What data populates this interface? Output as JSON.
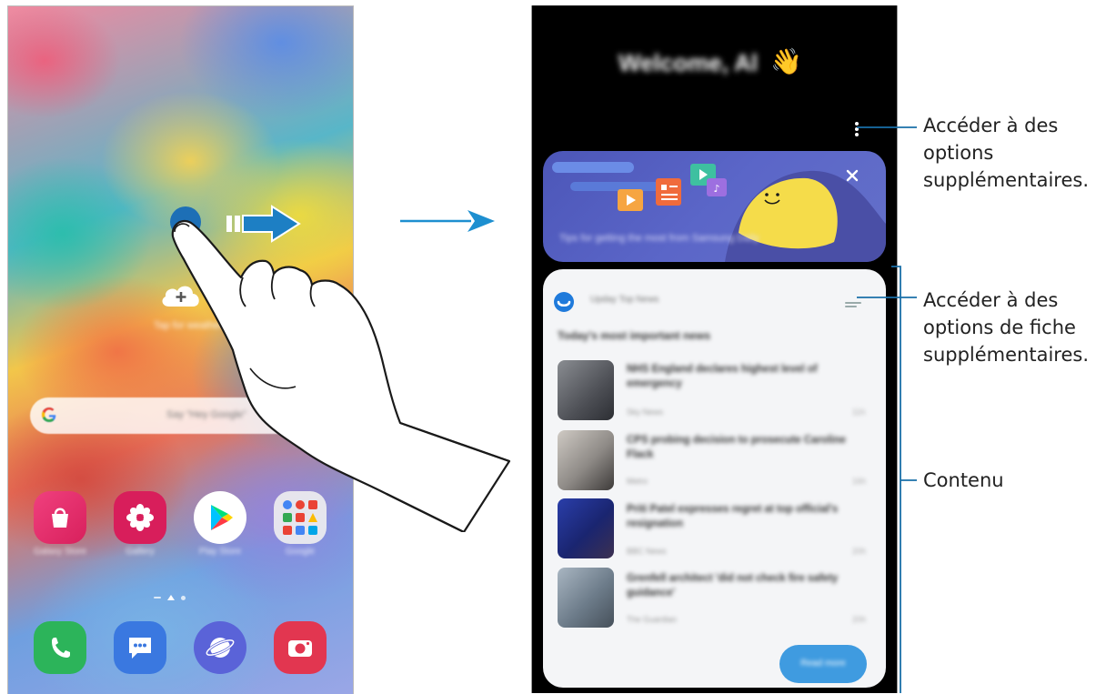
{
  "left_phone": {
    "cloud_hint": "Tap for weather",
    "search": {
      "hint": "Say \"Hey Google\""
    },
    "apps": [
      {
        "name": "Galaxy Store",
        "icon": "galaxy-store-icon",
        "color": "#e8307a"
      },
      {
        "name": "Gallery",
        "icon": "gallery-icon",
        "color": "#d81e5b"
      },
      {
        "name": "Play Store",
        "icon": "play-store-icon",
        "color": "#ffffff"
      },
      {
        "name": "Google",
        "icon": "google-folder-icon",
        "color": "#f2f2f2"
      }
    ],
    "dock": [
      {
        "name": "Phone",
        "icon": "phone-icon",
        "color": "#29b35a"
      },
      {
        "name": "Messages",
        "icon": "messages-icon",
        "color": "#3a78e0"
      },
      {
        "name": "Internet",
        "icon": "internet-icon",
        "color": "#5a63d8"
      },
      {
        "name": "Camera",
        "icon": "camera-icon",
        "color": "#e23650"
      }
    ]
  },
  "right_phone": {
    "welcome": "Welcome, Al",
    "wave": "👋",
    "banner": {
      "text": "Tips for getting the most from Samsung Daily",
      "close": "✕"
    },
    "card": {
      "source": "Upday Top News",
      "headline": "Today's most important news",
      "news": [
        {
          "title": "NHS England declares highest level of emergency",
          "source": "Sky News",
          "time": "11h"
        },
        {
          "title": "CPS probing decision to prosecute Caroline Flack",
          "source": "Metro",
          "time": "16h"
        },
        {
          "title": "Priti Patel expresses regret at top official's resignation",
          "source": "BBC News",
          "time": "20h"
        },
        {
          "title": "Grenfell architect 'did not check fire safety guidance'",
          "source": "The Guardian",
          "time": "20h"
        }
      ],
      "read_more": "Read more"
    }
  },
  "callouts": {
    "more_options": [
      "Accéder à des",
      "options",
      "supplémentaires."
    ],
    "card_options": [
      "Accéder à des",
      "options de fiche",
      "supplémentaires."
    ],
    "content": "Contenu"
  },
  "colors": {
    "accent_blue": "#1d8fd0",
    "callout_line": "#1a6fa8",
    "tap_dot": "#1d6fb6"
  }
}
